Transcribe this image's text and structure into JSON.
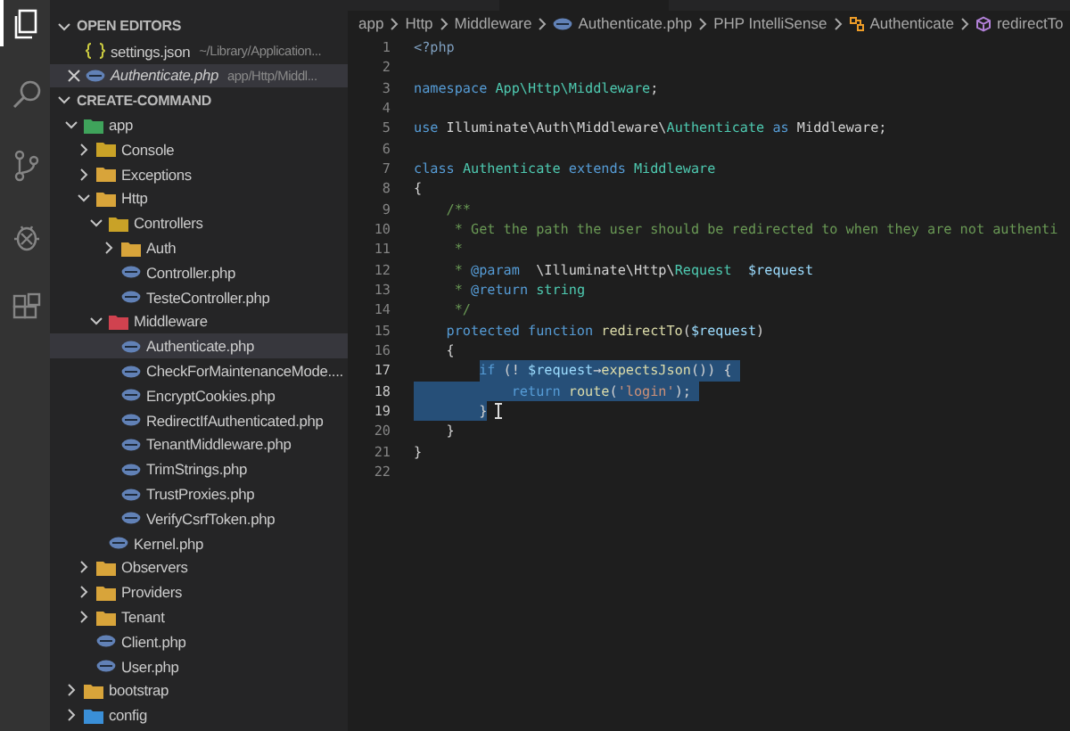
{
  "activity_bar": [
    {
      "kind": "files",
      "selected": true
    },
    {
      "kind": "search",
      "selected": false
    },
    {
      "kind": "source-control",
      "selected": false
    },
    {
      "kind": "debug",
      "selected": false
    },
    {
      "kind": "extensions",
      "selected": false
    }
  ],
  "sidebar": {
    "open_editors": {
      "title": "OPEN EDITORS",
      "expanded": true,
      "items": [
        {
          "name": "settings.json",
          "kind": "json",
          "description": "~/Library/Application...",
          "italic": false,
          "selected": false
        },
        {
          "name": "Authenticate.php",
          "kind": "php",
          "description": "app/Http/Middl...",
          "italic": true,
          "selected": true
        }
      ]
    },
    "project": {
      "title": "CREATE-COMMAND",
      "expanded": true,
      "tree": [
        {
          "name": "app",
          "kind": "folder",
          "color": "#3fa35b",
          "expanded": true,
          "selected": false,
          "children": [
            {
              "name": "Console",
              "kind": "folder",
              "color": "#c9a227",
              "expanded": false,
              "selected": false
            },
            {
              "name": "Exceptions",
              "kind": "folder",
              "color": "#d8a43a",
              "expanded": false,
              "selected": false
            },
            {
              "name": "Http",
              "kind": "folder",
              "color": "#d8a43a",
              "expanded": true,
              "selected": false,
              "children": [
                {
                  "name": "Controllers",
                  "kind": "folder",
                  "color": "#c9a227",
                  "expanded": true,
                  "selected": false,
                  "children": [
                    {
                      "name": "Auth",
                      "kind": "folder",
                      "color": "#d8a43a",
                      "expanded": false,
                      "selected": false
                    },
                    {
                      "name": "Controller.php",
                      "kind": "php",
                      "selected": false
                    },
                    {
                      "name": "TesteController.php",
                      "kind": "php",
                      "selected": false
                    }
                  ]
                },
                {
                  "name": "Middleware",
                  "kind": "folder",
                  "color": "#d0424f",
                  "expanded": true,
                  "selected": false,
                  "children": [
                    {
                      "name": "Authenticate.php",
                      "kind": "php",
                      "selected": true
                    },
                    {
                      "name": "CheckForMaintenanceMode....",
                      "kind": "php",
                      "selected": false
                    },
                    {
                      "name": "EncryptCookies.php",
                      "kind": "php",
                      "selected": false
                    },
                    {
                      "name": "RedirectIfAuthenticated.php",
                      "kind": "php",
                      "selected": false
                    },
                    {
                      "name": "TenantMiddleware.php",
                      "kind": "php",
                      "selected": false
                    },
                    {
                      "name": "TrimStrings.php",
                      "kind": "php",
                      "selected": false
                    },
                    {
                      "name": "TrustProxies.php",
                      "kind": "php",
                      "selected": false
                    },
                    {
                      "name": "VerifyCsrfToken.php",
                      "kind": "php",
                      "selected": false
                    }
                  ]
                },
                {
                  "name": "Kernel.php",
                  "kind": "php",
                  "selected": false
                }
              ]
            },
            {
              "name": "Observers",
              "kind": "folder",
              "color": "#d8a43a",
              "expanded": false,
              "selected": false
            },
            {
              "name": "Providers",
              "kind": "folder",
              "color": "#d8a43a",
              "expanded": false,
              "selected": false
            },
            {
              "name": "Tenant",
              "kind": "folder",
              "color": "#d8a43a",
              "expanded": false,
              "selected": false
            },
            {
              "name": "Client.php",
              "kind": "php",
              "selected": false
            },
            {
              "name": "User.php",
              "kind": "php",
              "selected": false
            }
          ]
        },
        {
          "name": "bootstrap",
          "kind": "folder",
          "color": "#d8a43a",
          "expanded": false,
          "selected": false
        },
        {
          "name": "config",
          "kind": "folder",
          "color": "#3a8fd8",
          "expanded": false,
          "selected": false
        }
      ]
    }
  },
  "breadcrumbs": [
    {
      "label": "app",
      "kind": "text"
    },
    {
      "label": "Http",
      "kind": "text"
    },
    {
      "label": "Middleware",
      "kind": "text"
    },
    {
      "label": "Authenticate.php",
      "kind": "php"
    },
    {
      "label": "PHP IntelliSense",
      "kind": "text"
    },
    {
      "label": "Authenticate",
      "kind": "class"
    },
    {
      "label": "redirectTo",
      "kind": "method"
    }
  ],
  "editor": {
    "lines": [
      {
        "number": "1",
        "selected": false,
        "tokens": [
          {
            "kind": "tag",
            "text": "<?php"
          }
        ]
      },
      {
        "number": "2",
        "selected": false
      },
      {
        "number": "3",
        "selected": false,
        "tokens": [
          {
            "kind": "keyword",
            "text": "namespace "
          },
          {
            "kind": "type",
            "text": "App\\Http\\Middleware"
          },
          {
            "kind": "plain",
            "text": ";"
          }
        ]
      },
      {
        "number": "4",
        "selected": false
      },
      {
        "number": "5",
        "selected": false,
        "tokens": [
          {
            "kind": "keyword",
            "text": "use "
          },
          {
            "kind": "plain",
            "text": "Illuminate\\Auth\\Middleware\\"
          },
          {
            "kind": "type",
            "text": "Authenticate"
          },
          {
            "kind": "keyword",
            "text": " as "
          },
          {
            "kind": "plain",
            "text": "Middleware;"
          }
        ]
      },
      {
        "number": "6",
        "selected": false
      },
      {
        "number": "7",
        "selected": false,
        "tokens": [
          {
            "kind": "keyword",
            "text": "class "
          },
          {
            "kind": "type",
            "text": "Authenticate"
          },
          {
            "kind": "keyword",
            "text": " extends "
          },
          {
            "kind": "type",
            "text": "Middleware"
          }
        ]
      },
      {
        "number": "8",
        "selected": false,
        "tokens": [
          {
            "kind": "plain",
            "text": "{"
          }
        ]
      },
      {
        "number": "9",
        "selected": false,
        "tokens": [
          {
            "kind": "comment",
            "text": "    /**"
          }
        ]
      },
      {
        "number": "10",
        "selected": false,
        "tokens": [
          {
            "kind": "comment",
            "text": "     * Get the path the user should be redirected to when they are not authenti"
          }
        ]
      },
      {
        "number": "11",
        "selected": false,
        "tokens": [
          {
            "kind": "comment",
            "text": "     *"
          }
        ]
      },
      {
        "number": "12",
        "selected": false,
        "tokens": [
          {
            "kind": "comment",
            "text": "     * "
          },
          {
            "kind": "keyword",
            "text": "@param"
          },
          {
            "kind": "plain",
            "text": "  \\Illuminate\\Http\\"
          },
          {
            "kind": "type",
            "text": "Request"
          },
          {
            "kind": "variable",
            "text": "  $request"
          }
        ]
      },
      {
        "number": "13",
        "selected": false,
        "tokens": [
          {
            "kind": "comment",
            "text": "     * "
          },
          {
            "kind": "keyword",
            "text": "@return"
          },
          {
            "kind": "type",
            "text": " string"
          }
        ]
      },
      {
        "number": "14",
        "selected": false,
        "tokens": [
          {
            "kind": "comment",
            "text": "     */"
          }
        ]
      },
      {
        "number": "15",
        "selected": false,
        "tokens": [
          {
            "kind": "keyword",
            "text": "    protected function "
          },
          {
            "kind": "function",
            "text": "redirectTo"
          },
          {
            "kind": "plain",
            "text": "("
          },
          {
            "kind": "variable",
            "text": "$request"
          },
          {
            "kind": "plain",
            "text": ")"
          }
        ]
      },
      {
        "number": "16",
        "selected": false,
        "tokens": [
          {
            "kind": "plain",
            "text": "    {"
          }
        ]
      },
      {
        "number": "17",
        "selected": true,
        "tokens": [
          {
            "kind": "keyword",
            "text": "        if"
          },
          {
            "kind": "plain",
            "text": " (! "
          },
          {
            "kind": "variable",
            "text": "$request"
          },
          {
            "kind": "plain",
            "text": "→"
          },
          {
            "kind": "function",
            "text": "expectsJson"
          },
          {
            "kind": "plain",
            "text": "()) { "
          }
        ]
      },
      {
        "number": "18",
        "selected": true,
        "tokens": [
          {
            "kind": "keyword",
            "text": "            return "
          },
          {
            "kind": "function",
            "text": "route"
          },
          {
            "kind": "plain",
            "text": "("
          },
          {
            "kind": "string",
            "text": "'login'"
          },
          {
            "kind": "plain",
            "text": "); "
          }
        ]
      },
      {
        "number": "19",
        "selected": true,
        "tokens": [
          {
            "kind": "plain",
            "text": "        }"
          }
        ]
      },
      {
        "number": "20",
        "selected": false,
        "tokens": [
          {
            "kind": "plain",
            "text": "    }"
          }
        ]
      },
      {
        "number": "21",
        "selected": false,
        "tokens": [
          {
            "kind": "plain",
            "text": "}"
          }
        ]
      },
      {
        "number": "22",
        "selected": false
      }
    ]
  }
}
